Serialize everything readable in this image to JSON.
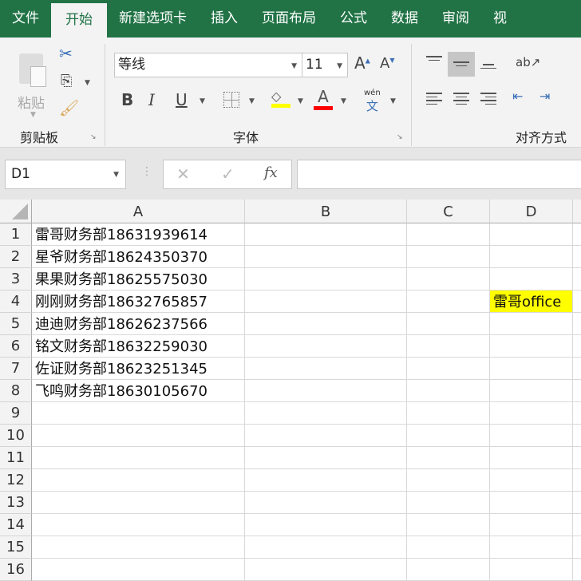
{
  "tabs": [
    "文件",
    "开始",
    "新建选项卡",
    "插入",
    "页面布局",
    "公式",
    "数据",
    "审阅",
    "视"
  ],
  "ribbon": {
    "paste_label": "粘贴",
    "clipboard_group": "剪贴板",
    "font_group": "字体",
    "align_group": "对齐方式",
    "font_name": "等线",
    "font_size": "11",
    "bold": "B",
    "italic": "I",
    "underline": "U",
    "phonetic_top": "wén",
    "phonetic_bottom": "文",
    "fill_color": "#ffff00",
    "font_color": "#ff0000"
  },
  "formula_bar": {
    "name_box": "D1",
    "fx": "fx",
    "value": ""
  },
  "columns": [
    "A",
    "B",
    "C",
    "D"
  ],
  "rows": [
    "1",
    "2",
    "3",
    "4",
    "5",
    "6",
    "7",
    "8",
    "9",
    "10",
    "11",
    "12",
    "13",
    "14",
    "15",
    "16"
  ],
  "cells_a": [
    "雷哥财务部18631939614",
    "星爷财务部18624350370",
    "果果财务部18625575030",
    "刚刚财务部18632765857",
    "迪迪财务部18626237566",
    "铭文财务部18632259030",
    "佐证财务部18623251345",
    "飞鸣财务部18630105670"
  ],
  "cell_d4": {
    "value": "雷哥office",
    "fill": "#ffff00"
  }
}
